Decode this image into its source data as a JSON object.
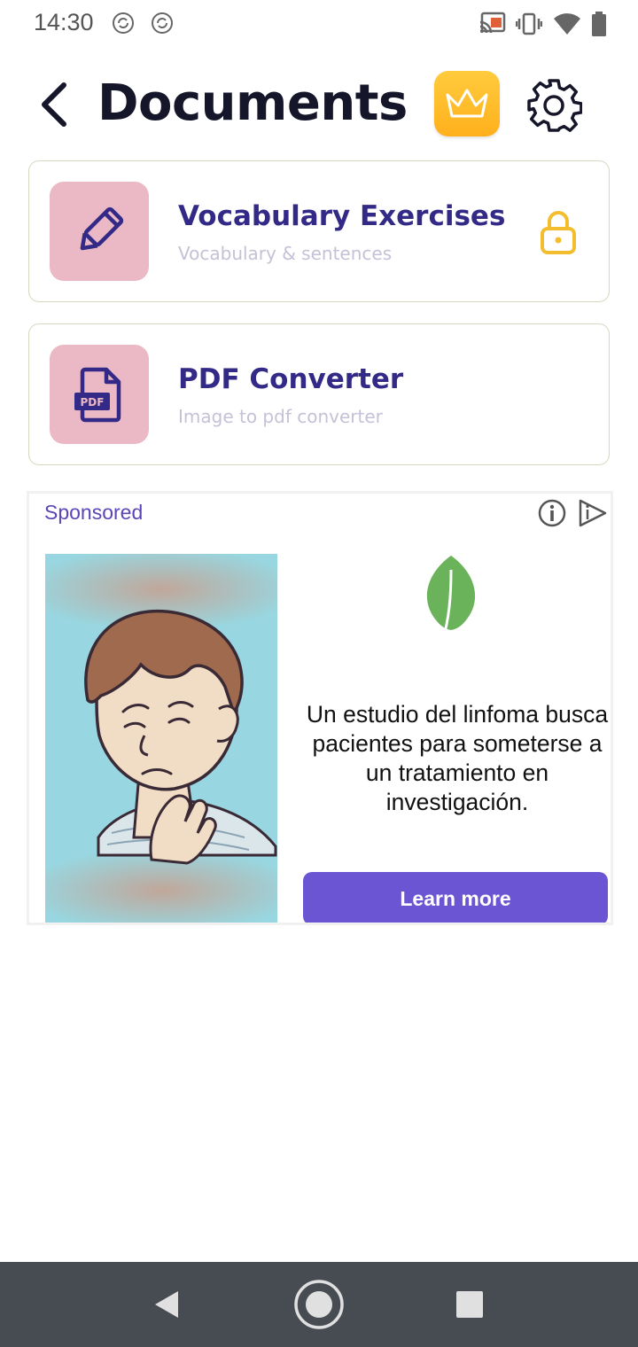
{
  "status_bar": {
    "time": "14:30",
    "notification_icons": [
      "sync-icon",
      "sync-icon"
    ],
    "right_icons": [
      "cast-icon",
      "vibrate-icon",
      "wifi-icon",
      "battery-icon"
    ]
  },
  "header": {
    "title": "Documents",
    "back_icon": "chevron-left-icon",
    "premium_icon": "crown-icon",
    "settings_icon": "gear-icon"
  },
  "cards": [
    {
      "title": "Vocabulary Exercises",
      "subtitle": "Vocabulary & sentences",
      "icon": "pencil-icon",
      "locked": true
    },
    {
      "title": "PDF Converter",
      "subtitle": "Image to pdf converter",
      "icon": "pdf-file-icon",
      "icon_text": "PDF",
      "locked": false
    }
  ],
  "ad": {
    "sponsored_label": "Sponsored",
    "headline": "Un estudio del linfoma busca pacientes para someterse a un tratamiento en investigación.",
    "cta_label": "Learn more",
    "icons": [
      "info-icon",
      "adchoices-icon",
      "leaf-icon"
    ]
  },
  "nav_bar": {
    "buttons": [
      "back-triangle-icon",
      "home-circle-icon",
      "recents-square-icon"
    ]
  },
  "colors": {
    "title": "#16162b",
    "card_title": "#322a86",
    "card_icon_bg": "#ebb9c6",
    "premium": "#ffb01c",
    "lock": "#f3bd2e",
    "cta": "#6b55d3",
    "nav_bar": "#464c52"
  }
}
